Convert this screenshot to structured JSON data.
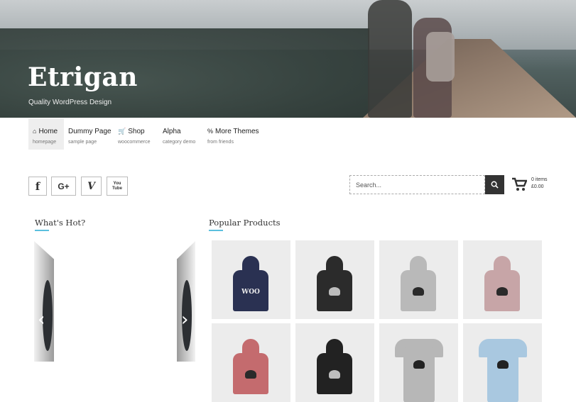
{
  "site": {
    "title": "Etrigan",
    "tagline": "Quality WordPress Design"
  },
  "nav": [
    {
      "icon": "home-icon",
      "glyph": "⌂",
      "label": "Home",
      "sub": "homepage",
      "active": true
    },
    {
      "icon": "",
      "glyph": "",
      "label": "Dummy Page",
      "sub": "sample page",
      "active": false
    },
    {
      "icon": "cart-icon",
      "glyph": "🛒",
      "label": "Shop",
      "sub": "woocommerce",
      "active": false
    },
    {
      "icon": "",
      "glyph": "",
      "label": "Alpha",
      "sub": "category demo",
      "active": false
    },
    {
      "icon": "link-icon",
      "glyph": "%",
      "label": "More Themes",
      "sub": "from friends",
      "active": false
    }
  ],
  "social": [
    {
      "name": "facebook-icon",
      "glyph": "f"
    },
    {
      "name": "google-plus-icon",
      "glyph": "G+"
    },
    {
      "name": "vine-icon",
      "glyph": "V"
    },
    {
      "name": "youtube-icon",
      "glyph": "You\nTube"
    }
  ],
  "search": {
    "placeholder": "Search..."
  },
  "cart": {
    "items": "0 items",
    "total": "£0.00"
  },
  "sections": {
    "hot": "What's Hot?",
    "popular": "Popular Products"
  },
  "colors": {
    "accent": "#5bc0de",
    "dark": "#333333"
  },
  "products": [
    {
      "type": "hoodie",
      "color": "#2a3152",
      "print": "WOO"
    },
    {
      "type": "hoodie",
      "color": "#2b2b2b",
      "print": ""
    },
    {
      "type": "hoodie",
      "color": "#b9b9b9",
      "print": ""
    },
    {
      "type": "hoodie",
      "color": "#c7a5a7",
      "print": ""
    },
    {
      "type": "hoodie",
      "color": "#c46b6e",
      "print": ""
    },
    {
      "type": "hoodie",
      "color": "#222222",
      "print": ""
    },
    {
      "type": "tee",
      "color": "#b7b7b7",
      "print": ""
    },
    {
      "type": "tee",
      "color": "#a9c8e0",
      "print": ""
    }
  ]
}
